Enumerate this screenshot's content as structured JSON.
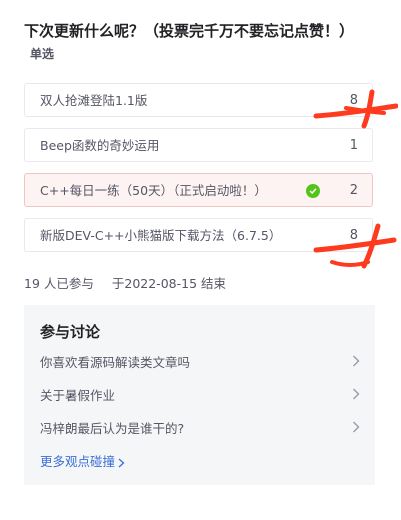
{
  "poll": {
    "title": "下次更新什么呢？（投票完千万不要忘记点赞！）",
    "type_label": "单选",
    "options": [
      {
        "label": "双人抢滩登陆1.1版",
        "count": "8"
      },
      {
        "label": "Beep函数的奇妙运用",
        "count": "1"
      },
      {
        "label": "C++每日一练（50天）（正式启动啦！）",
        "count": "2",
        "selected": true
      },
      {
        "label": "新版DEV-C++小熊猫版下载方法（6.7.5）",
        "count": "8"
      }
    ],
    "participants": "19 人已参与",
    "end_date": "于2022-08-15 结束"
  },
  "discussion": {
    "title": "参与讨论",
    "items": [
      {
        "label": "你喜欢看源码解读类文章吗"
      },
      {
        "label": "关于暑假作业"
      },
      {
        "label": "冯梓朗最后认为是谁干的?"
      }
    ],
    "more_label": "更多观点碰撞"
  },
  "colors": {
    "annotation": "#ff3b1f",
    "selected_check": "#52c41a",
    "link": "#3a6fd8"
  }
}
